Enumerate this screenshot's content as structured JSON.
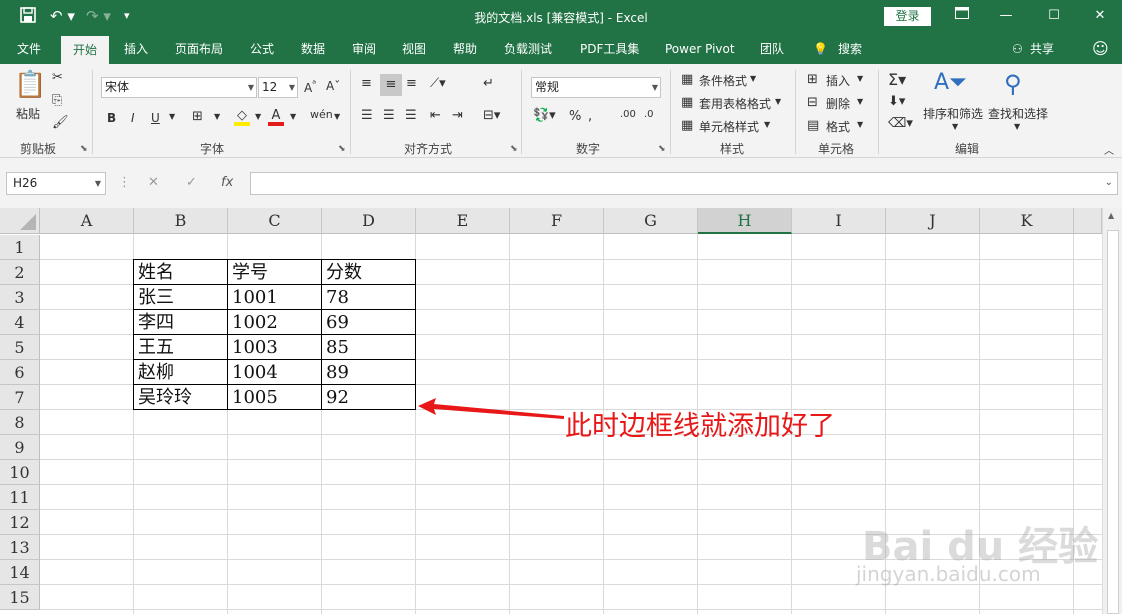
{
  "window": {
    "title": "我的文档.xls  [兼容模式]  -  Excel",
    "login_label": "登录",
    "save_icon": "save-icon",
    "minimize": "—",
    "restore": "☐",
    "close": "✕"
  },
  "tabs": [
    "文件",
    "开始",
    "插入",
    "页面布局",
    "公式",
    "数据",
    "审阅",
    "视图",
    "帮助",
    "负载测试",
    "PDF工具集",
    "Power Pivot",
    "团队",
    "搜索"
  ],
  "share_label": "共享",
  "ribbon": {
    "paste_label": "粘贴",
    "groups": {
      "clipboard": "剪贴板",
      "font": "字体",
      "align": "对齐方式",
      "number": "数字",
      "style": "样式",
      "cells": "单元格",
      "edit": "编辑"
    },
    "font_name": "宋体",
    "font_size": "12",
    "number_format": "常规",
    "style_items": [
      "条件格式",
      "套用表格格式",
      "单元格样式"
    ],
    "cells_items": [
      "插入",
      "删除",
      "格式"
    ],
    "edit_items": [
      "排序和筛选",
      "查找和选择"
    ],
    "font_buttons": [
      "B",
      "I",
      "U"
    ]
  },
  "formula_bar": {
    "name_box": "H26",
    "fx": "fx",
    "content": ""
  },
  "sheet": {
    "columns": [
      "A",
      "B",
      "C",
      "D",
      "E",
      "F",
      "G",
      "H",
      "I",
      "J",
      "K"
    ],
    "selected_column": "H",
    "rows": [
      "1",
      "2",
      "3",
      "4",
      "5",
      "6",
      "7",
      "8",
      "9",
      "10",
      "11",
      "12",
      "13",
      "14",
      "15"
    ],
    "table": [
      [
        "姓名",
        "学号",
        "分数"
      ],
      [
        "张三",
        "1001",
        "78"
      ],
      [
        "李四",
        "1002",
        "69"
      ],
      [
        "王五",
        "1003",
        "85"
      ],
      [
        "赵柳",
        "1004",
        "89"
      ],
      [
        "吴玲玲",
        "1005",
        "92"
      ]
    ]
  },
  "annotation": "此时边框线就添加好了",
  "annotation_color": "#e81818",
  "watermark": {
    "main": "Bai du 经验",
    "sub": "jingyan.baidu.com"
  },
  "colors": {
    "brand": "#217346"
  }
}
